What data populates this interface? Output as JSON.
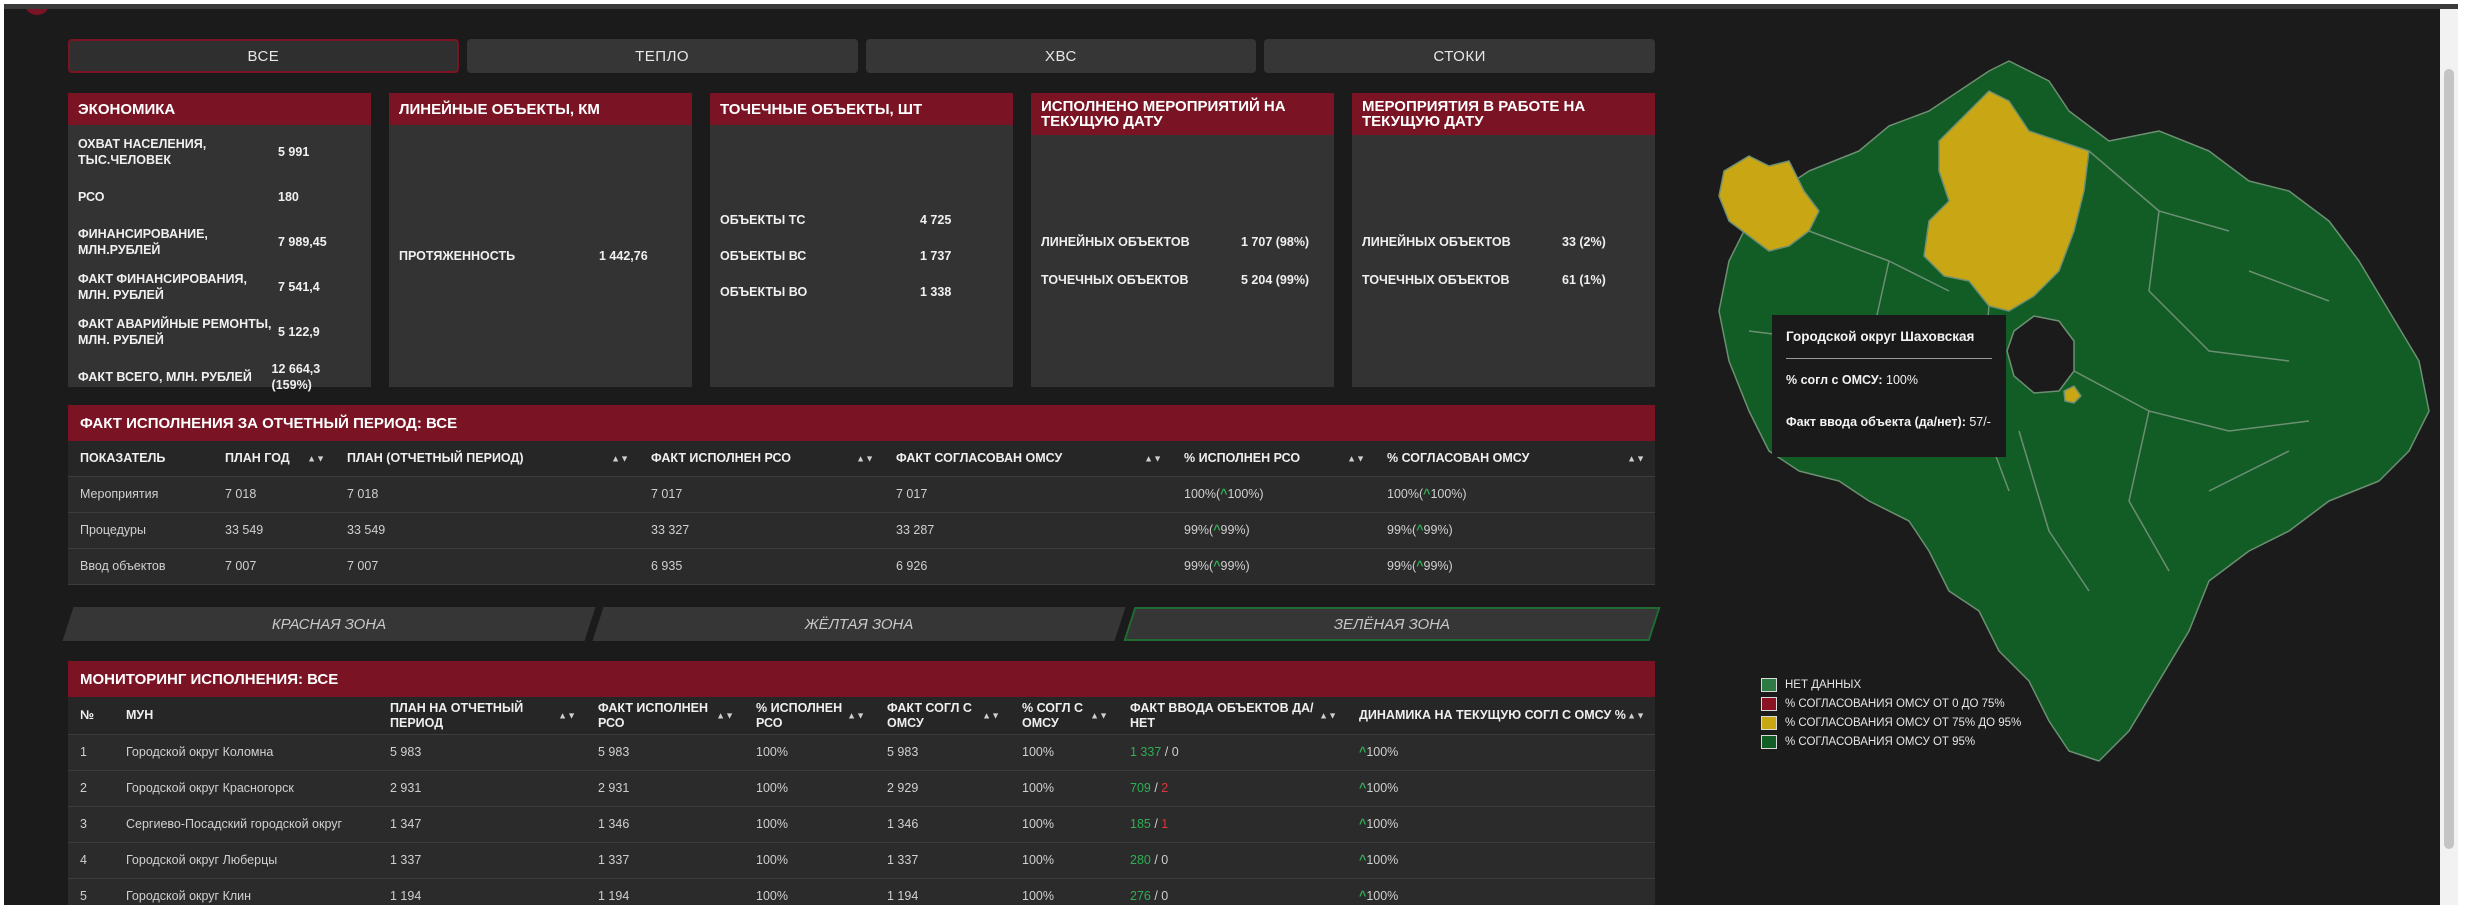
{
  "tabs": [
    "ВСЕ",
    "ТЕПЛО",
    "ХВС",
    "СТОКИ"
  ],
  "cards": {
    "economy": {
      "title": "ЭКОНОМИКА",
      "rows": [
        {
          "label": "ОХВАТ НАСЕЛЕНИЯ, ТЫС.ЧЕЛОВЕК",
          "value": "5 991"
        },
        {
          "label": "РСО",
          "value": "180"
        },
        {
          "label": "ФИНАНСИРОВАНИЕ, МЛН.РУБЛЕЙ",
          "value": "7 989,45"
        },
        {
          "label": "ФАКТ ФИНАНСИРОВАНИЯ, МЛН. РУБЛЕЙ",
          "value": "7 541,4"
        },
        {
          "label": "ФАКТ АВАРИЙНЫЕ РЕМОНТЫ, МЛН. РУБЛЕЙ",
          "value": "5 122,9"
        },
        {
          "label": "ФАКТ ВСЕГО, МЛН. РУБЛЕЙ",
          "value": "12 664,3 (159%)"
        }
      ]
    },
    "linear": {
      "title": "ЛИНЕЙНЫЕ ОБЪЕКТЫ, КМ",
      "rows": [
        {
          "label": "ПРОТЯЖЕННОСТЬ",
          "value": "1 442,76"
        }
      ]
    },
    "point": {
      "title": "ТОЧЕЧНЫЕ ОБЪЕКТЫ, ШТ",
      "rows": [
        {
          "label": "ОБЪЕКТЫ ТС",
          "value": "4 725"
        },
        {
          "label": "ОБЪЕКТЫ ВС",
          "value": "1 737"
        },
        {
          "label": "ОБЪЕКТЫ ВО",
          "value": "1 338"
        }
      ]
    },
    "done": {
      "title": "ИСПОЛНЕНО МЕРОПРИЯТИЙ НА ТЕКУЩУЮ ДАТУ",
      "rows": [
        {
          "label": "ЛИНЕЙНЫХ ОБЪЕКТОВ",
          "value": "1 707 (98%)"
        },
        {
          "label": "ТОЧЕЧНЫХ ОБЪЕКТОВ",
          "value": "5 204 (99%)"
        }
      ]
    },
    "inwork": {
      "title": "МЕРОПРИЯТИЯ В РАБОТЕ НА ТЕКУЩУЮ ДАТУ",
      "rows": [
        {
          "label": "ЛИНЕЙНЫХ ОБЪЕКТОВ",
          "value": "33 (2%)"
        },
        {
          "label": "ТОЧЕЧНЫХ ОБЪЕКТОВ",
          "value": "61 (1%)"
        }
      ]
    }
  },
  "fact": {
    "title": "ФАКТ ИСПОЛНЕНИЯ ЗА ОТЧЕТНЫЙ ПЕРИОД: ВСЕ",
    "columns": [
      "ПОКАЗАТЕЛЬ",
      "ПЛАН ГОД",
      "ПЛАН (ОТЧЕТНЫЙ ПЕРИОД)",
      "ФАКТ ИСПОЛНЕН РСО",
      "ФАКТ СОГЛАСОВАН ОМСУ",
      "% ИСПОЛНЕН РСО",
      "% СОГЛАСОВАН ОМСУ"
    ],
    "rows": [
      {
        "name": "Мероприятия",
        "plan_year": "7 018",
        "plan_period": "7 018",
        "fact_rso": "7 017",
        "fact_omsu": "7 017",
        "pct_rso": "100%(",
        "pct_rso_up": "100%)",
        "pct_omsu": "100%(",
        "pct_omsu_up": "100%)"
      },
      {
        "name": "Процедуры",
        "plan_year": "33 549",
        "plan_period": "33 549",
        "fact_rso": "33 327",
        "fact_omsu": "33 287",
        "pct_rso": "99%(",
        "pct_rso_up": "99%)",
        "pct_omsu": "99%(",
        "pct_omsu_up": "99%)"
      },
      {
        "name": "Ввод объектов",
        "plan_year": "7 007",
        "plan_period": "7 007",
        "fact_rso": "6 935",
        "fact_omsu": "6 926",
        "pct_rso": "99%(",
        "pct_rso_up": "99%)",
        "pct_omsu": "99%(",
        "pct_omsu_up": "99%)"
      }
    ]
  },
  "zones": [
    "КРАСНАЯ ЗОНА",
    "ЖЁЛТАЯ ЗОНА",
    "ЗЕЛЁНАЯ ЗОНА"
  ],
  "monitoring": {
    "title": "МОНИТОРИНГ ИСПОЛНЕНИЯ: ВСЕ",
    "columns": [
      "№",
      "МУН",
      "ПЛАН НА ОТЧЕТНЫЙ ПЕРИОД",
      "ФАКТ ИСПОЛНЕН РСО",
      "% ИСПОЛНЕН РСО",
      "ФАКТ СОГЛ С ОМСУ",
      "% СОГЛ С ОМСУ",
      "ФАКТ ВВОДА ОБЪЕКТОВ ДА/НЕТ",
      "ДИНАМИКА НА ТЕКУЩУЮ СОГЛ С ОМСУ %"
    ],
    "rows": [
      {
        "n": "1",
        "mun": "Городской округ Коломна",
        "plan": "5 983",
        "fact_rso": "5 983",
        "pct_rso": "100%",
        "fact_omsu": "5 983",
        "pct_omsu": "100%",
        "yes": "1 337",
        "no": "0",
        "no_red": false,
        "dyn": "100%"
      },
      {
        "n": "2",
        "mun": "Городской округ Красногорск",
        "plan": "2 931",
        "fact_rso": "2 931",
        "pct_rso": "100%",
        "fact_omsu": "2 929",
        "pct_omsu": "100%",
        "yes": "709",
        "no": "2",
        "no_red": true,
        "dyn": "100%"
      },
      {
        "n": "3",
        "mun": "Сергиево-Посадский городской округ",
        "plan": "1 347",
        "fact_rso": "1 346",
        "pct_rso": "100%",
        "fact_omsu": "1 346",
        "pct_omsu": "100%",
        "yes": "185",
        "no": "1",
        "no_red": true,
        "dyn": "100%"
      },
      {
        "n": "4",
        "mun": "Городской округ Люберцы",
        "plan": "1 337",
        "fact_rso": "1 337",
        "pct_rso": "100%",
        "fact_omsu": "1 337",
        "pct_omsu": "100%",
        "yes": "280",
        "no": "0",
        "no_red": false,
        "dyn": "100%"
      },
      {
        "n": "5",
        "mun": "Городской округ Клин",
        "plan": "1 194",
        "fact_rso": "1 194",
        "pct_rso": "100%",
        "fact_omsu": "1 194",
        "pct_omsu": "100%",
        "yes": "276",
        "no": "0",
        "no_red": false,
        "dyn": "100%"
      }
    ]
  },
  "tooltip": {
    "title": "Городской округ Шаховская",
    "line1_label": "% согл с ОМСУ:",
    "line1_value": "100%",
    "line2_label": "Факт ввода объекта (да/нет):",
    "line2_value": "57/-"
  },
  "legend": [
    {
      "label": "НЕТ ДАННЫХ",
      "color": "#2d7a45"
    },
    {
      "label": "% СОГЛАСОВАНИЯ ОМСУ ОТ 0 ДО 75%",
      "color": "#8a1424"
    },
    {
      "label": "% СОГЛАСОВАНИЯ ОМСУ ОТ 75% ДО 95%",
      "color": "#c9a614"
    },
    {
      "label": "% СОГЛАСОВАНИЯ ОМСУ ОТ 95%",
      "color": "#125c26"
    }
  ],
  "colors": {
    "accent": "#7a1424",
    "green": "#125c26",
    "yellow": "#c9a614",
    "up_arrow": "#2fae55"
  }
}
